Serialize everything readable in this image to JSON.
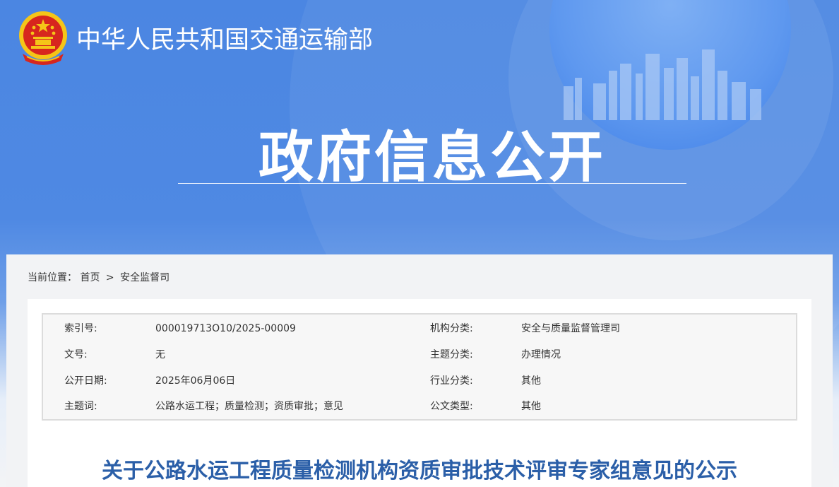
{
  "header": {
    "ministry_name": "中华人民共和国交通运输部",
    "emblem_icon": "national-emblem-icon",
    "banner_title": "政府信息公开"
  },
  "breadcrumb": {
    "label": "当前位置：",
    "home": "首页",
    "separator": ">",
    "current": "安全监督司"
  },
  "metadata": {
    "rows": [
      {
        "label1": "索引号:",
        "value1": "000019713O10/2025-00009",
        "label2": "机构分类:",
        "value2": "安全与质量监督管理司"
      },
      {
        "label1": "文号:",
        "value1": "无",
        "label2": "主题分类:",
        "value2": "办理情况"
      },
      {
        "label1": "公开日期:",
        "value1": "2025年06月06日",
        "label2": "行业分类:",
        "value2": "其他"
      },
      {
        "label1": "主题词:",
        "value1": "公路水运工程；质量检测；资质审批；意见",
        "label2": "公文类型:",
        "value2": "其他"
      }
    ]
  },
  "document": {
    "title": "关于公路水运工程质量检测机构资质审批技术评审专家组意见的公示"
  },
  "colors": {
    "banner_blue": "#4b86e2",
    "title_blue": "#2b5fa8",
    "emblem_red": "#d7261e",
    "emblem_gold": "#f5c518"
  }
}
